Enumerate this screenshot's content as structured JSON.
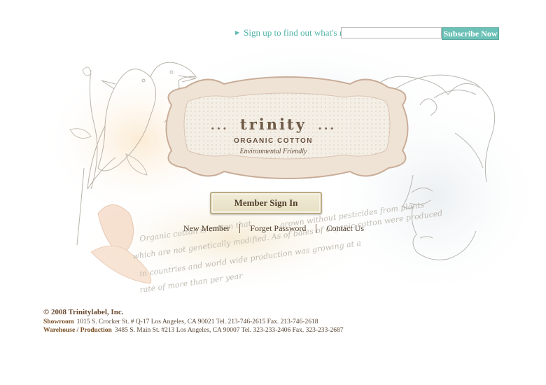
{
  "signup": {
    "label": "Sign up to find out what's new",
    "email_value": "",
    "subscribe_label": "Subscribe Now"
  },
  "logo": {
    "dots_left": "...",
    "name": "trinity",
    "dots_right": "...",
    "subtitle": "ORGANIC COTTON",
    "tagline": "Environmental Friendly"
  },
  "member_signin_label": "Member Sign In",
  "links": {
    "new_member": "New Member",
    "forget_password": "Forget Password",
    "contact_us": "Contact Us"
  },
  "background_script_lines": [
    "Organic cotton is cotton that",
    "grown without pesticides from plants",
    "which are not genetically modified. As of bales of organic cotton were produced",
    "in countries and world wide production was growing at a",
    "rate of more than per year"
  ],
  "footer": {
    "copyright": "© 2008 Trinitylabel, Inc.",
    "showroom_label": "Showroom",
    "showroom_text": "1015 S. Crocker St. # Q-17 Los Angeles, CA 90021 Tel. 213-746-2615   Fax. 213-746-2618",
    "warehouse_label": "Warehouse / Production",
    "warehouse_text": "3485 S. Main St. #213 Los Angeles, CA 90007  Tel. 323-233-2406   Fax. 323-233-2687"
  },
  "colors": {
    "accent_teal": "#6cc1b7",
    "brown_text": "#5a4634",
    "label_brown": "#7a4d22"
  }
}
